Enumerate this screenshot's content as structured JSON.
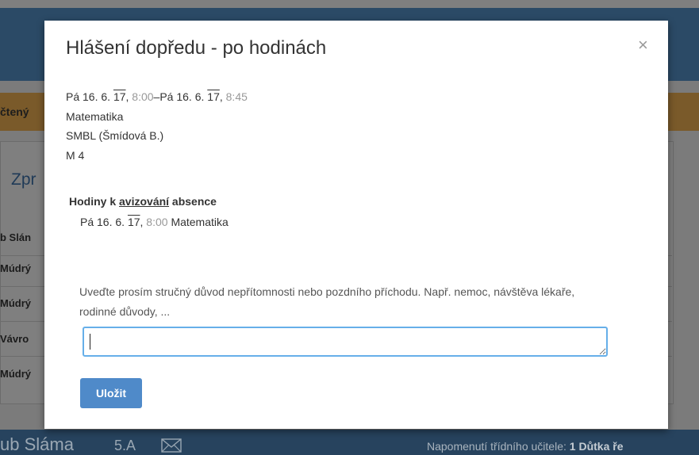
{
  "background": {
    "orange_bar_text": "čtený",
    "section_title": "Zpr",
    "rows": [
      "b Slán",
      "Múdrý",
      "Múdrý",
      "Vávro",
      "Múdrý"
    ],
    "footer": {
      "name": "ub Sláma",
      "class_name": "5.A",
      "mail_icon": "envelope-icon",
      "right_prefix": "Napomenutí třídního učitele:",
      "right_count": "1",
      "right_suffix": "Důtka ře"
    }
  },
  "modal": {
    "title": "Hlášení dopředu - po hodinách",
    "close_label": "×",
    "lesson": {
      "start_day": "Pá 16. 6.",
      "start_year": "17",
      "start_sep": ",",
      "start_time": "8:00",
      "dash": "–",
      "end_day": "Pá 16. 6.",
      "end_year": "17",
      "end_sep": ",",
      "end_time": "8:45",
      "subject": "Matematika",
      "teacher": "SMBL (Šmídová B.)",
      "room": "M 4"
    },
    "hours": {
      "title_prefix": "Hodiny k ",
      "title_underlined": "avizování",
      "title_suffix": " absence",
      "items": [
        {
          "day": "Pá 16. 6.",
          "year": "17",
          "sep": ",",
          "time": "8:00",
          "subject": "Matematika"
        }
      ]
    },
    "hint": "Uveďte prosím stručný důvod nepřítomnosti nebo pozdního příchodu. Např. nemoc, návštěva lékaře, rodinné důvody, ...",
    "reason_value": "",
    "save_label": "Uložit"
  }
}
